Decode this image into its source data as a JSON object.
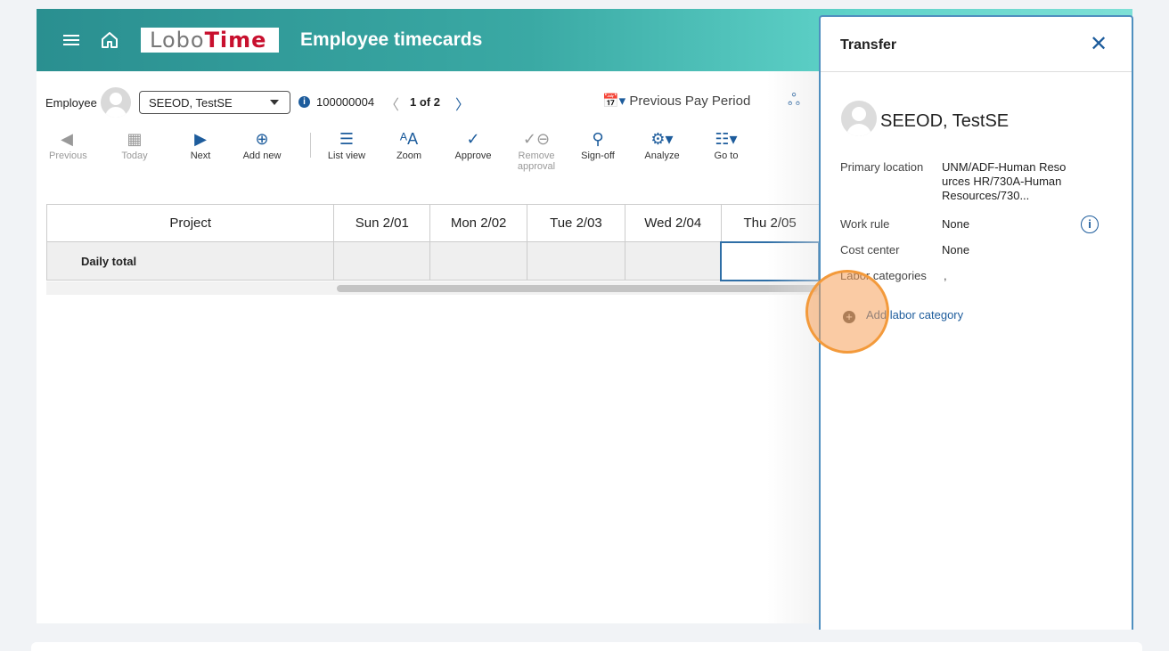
{
  "header": {
    "menu_icon": "hamburger-icon",
    "home_icon": "home-icon",
    "logo_part1": "Lobo",
    "logo_part2": "Time",
    "title": "Employee timecards"
  },
  "employee_bar": {
    "label": "Employee",
    "selected_employee": "SEEOD, TestSE",
    "employee_id": "100000004",
    "pager_prev": "〈",
    "pager_text": "1 of 2",
    "pager_next": "〉",
    "period_label": "Previous Pay Period"
  },
  "toolbar": {
    "buttons": [
      {
        "label": "Previous",
        "icon": "prev-icon",
        "disabled": true
      },
      {
        "label": "Today",
        "icon": "calendar-icon",
        "disabled": true
      },
      {
        "label": "Next",
        "icon": "next-icon",
        "disabled": false
      },
      {
        "label": "Add new",
        "icon": "plus-circle-icon",
        "disabled": false
      },
      {
        "label": "List view",
        "icon": "list-icon",
        "disabled": false
      },
      {
        "label": "Zoom",
        "icon": "font-size-icon",
        "disabled": false
      },
      {
        "label": "Approve",
        "icon": "check-icon",
        "disabled": false
      },
      {
        "label": "Remove approval",
        "icon": "remove-approval-icon",
        "disabled": true
      },
      {
        "label": "Sign-off",
        "icon": "stamp-icon",
        "disabled": false
      },
      {
        "label": "Analyze",
        "icon": "analyze-icon",
        "disabled": false
      },
      {
        "label": "Go to",
        "icon": "goto-icon",
        "disabled": false
      }
    ]
  },
  "grid": {
    "columns": [
      "Project",
      "Sun 2/01",
      "Mon 2/02",
      "Tue 2/03",
      "Wed 2/04",
      "Thu 2/05"
    ],
    "rows": [
      {
        "label": "Daily total",
        "cells": [
          "",
          "",
          "",
          "",
          ""
        ]
      }
    ]
  },
  "panel": {
    "title": "Transfer",
    "close_icon": "close-icon",
    "employee_name": "SEEOD, TestSE",
    "fields": [
      {
        "label": "Primary location",
        "value": "UNM/ADF-Human Reso urces HR/730A-Human Resources/730..."
      },
      {
        "label": "Work rule",
        "value": "None"
      },
      {
        "label": "Cost center",
        "value": "None"
      },
      {
        "label": "Labor categories",
        "value": ","
      }
    ],
    "add_labor_label": "Add labor category"
  },
  "colors": {
    "header_start": "#2a8f90",
    "header_end": "#7ee0d6",
    "accent": "#1d5c9c",
    "logo_red": "#c8102e",
    "highlight": "#f39a3b"
  }
}
